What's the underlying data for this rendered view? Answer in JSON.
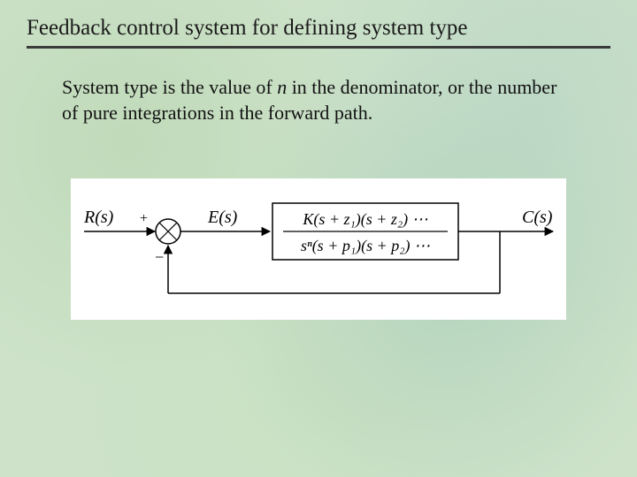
{
  "title": "Feedback control system for defining system type",
  "body": {
    "pre_n": "System type is the value of ",
    "n": "n",
    "post_n": " in the denominator, or the number of pure integrations in the forward path."
  },
  "diagram": {
    "input_label": "R(s)",
    "input_sign_plus": "+",
    "input_sign_minus": "−",
    "error_label": "E(s)",
    "output_label": "C(s)",
    "tf_numerator": "K(s + z₁)(s + z₂) ⋯",
    "tf_denominator": "sⁿ(s + p₁)(s + p₂) ⋯"
  }
}
